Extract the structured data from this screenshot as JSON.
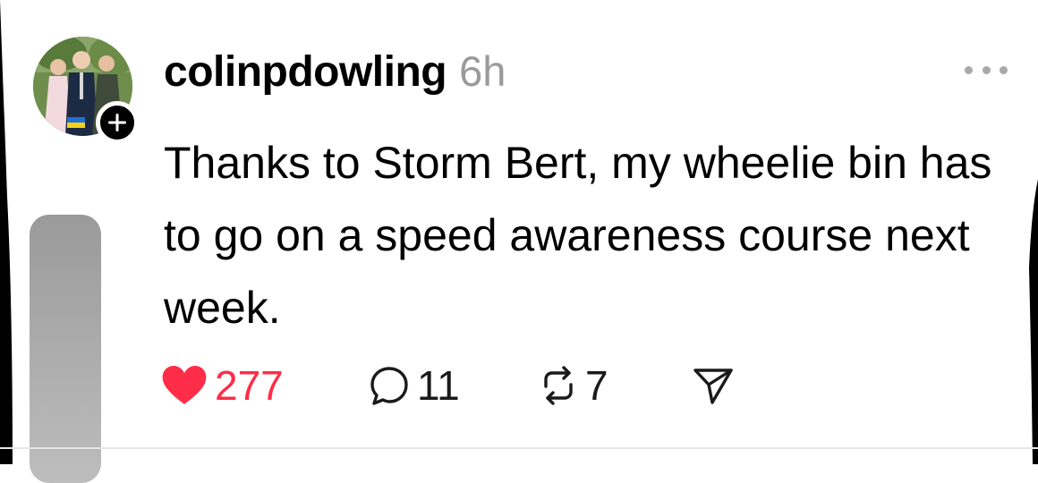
{
  "post": {
    "author": "colinpdowling",
    "time": "6h",
    "text": "Thanks to Storm Bert, my wheelie bin has to go on a speed awareness course next week."
  },
  "avatar": {
    "badge_icon": "plus-icon"
  },
  "actions": {
    "likes": "277",
    "replies": "11",
    "reposts": "7",
    "liked": true
  },
  "icons": {
    "like": "heart-icon",
    "reply": "speech-bubble-icon",
    "repost": "repost-arrows-icon",
    "share": "send-icon",
    "more": "more-dots-icon"
  },
  "colors": {
    "like_red": "#ff2d47",
    "muted_gray": "#9a9a9a",
    "text": "#000000"
  }
}
